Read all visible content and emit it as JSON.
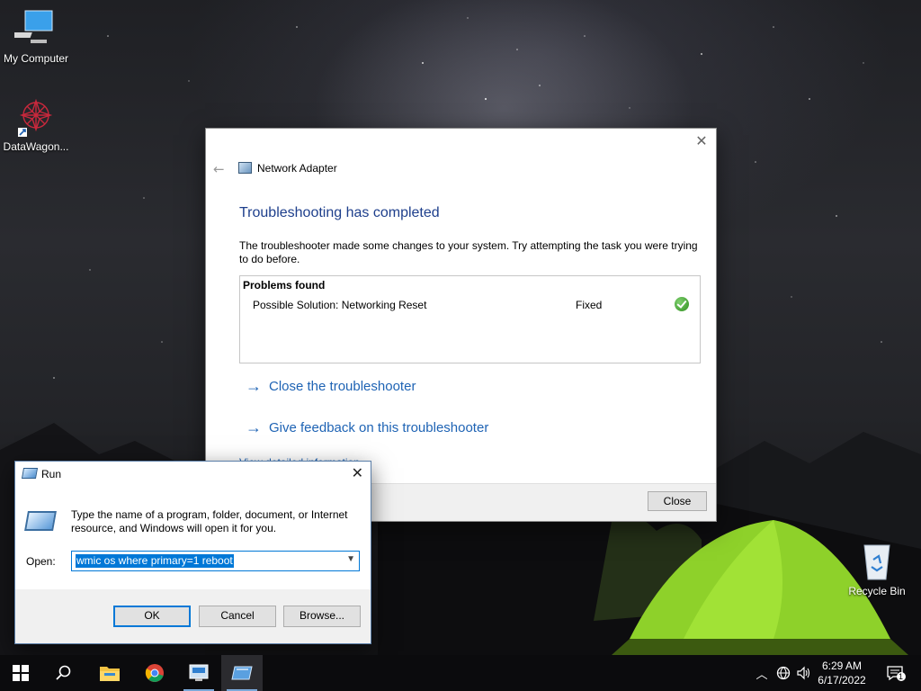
{
  "desktop": {
    "icons": [
      {
        "label": "My Computer",
        "icon": "computer-icon"
      },
      {
        "label": "DataWagon...",
        "icon": "datawagon-icon"
      },
      {
        "label": "Recycle Bin",
        "icon": "recycle-bin-icon"
      }
    ]
  },
  "troubleshooter": {
    "app_title": "Network Adapter",
    "heading": "Troubleshooting has completed",
    "description": "The troubleshooter made some changes to your system. Try attempting the task you were trying to do before.",
    "problems_header": "Problems found",
    "problem": "Possible Solution: Networking Reset",
    "status": "Fixed",
    "links": [
      "Close the troubleshooter",
      "Give feedback on this troubleshooter"
    ],
    "detail_link": "View detailed information",
    "close_button": "Close"
  },
  "run_dialog": {
    "title": "Run",
    "description": "Type the name of a program, folder, document, or Internet resource, and Windows will open it for you.",
    "open_label": "Open:",
    "input_value": "wmic os where primary=1 reboot",
    "ok": "OK",
    "cancel": "Cancel",
    "browse": "Browse..."
  },
  "taskbar": {
    "time": "6:29 AM",
    "date": "6/17/2022",
    "notification_count": "1",
    "apps": [
      "start-icon",
      "search-icon",
      "file-explorer-icon",
      "chrome-icon",
      "troubleshooter-icon",
      "run-icon"
    ]
  }
}
